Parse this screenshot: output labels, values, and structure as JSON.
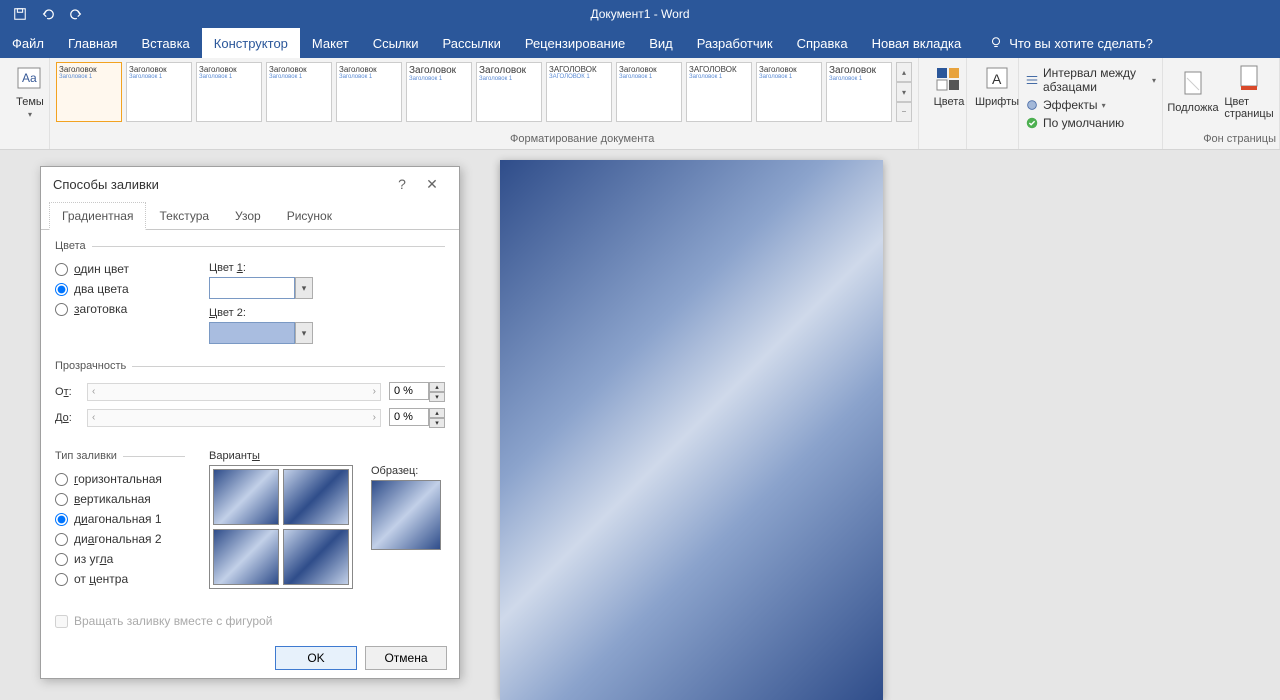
{
  "title": "Документ1 - Word",
  "tabs": [
    "Файл",
    "Главная",
    "Вставка",
    "Конструктор",
    "Макет",
    "Ссылки",
    "Рассылки",
    "Рецензирование",
    "Вид",
    "Разработчик",
    "Справка",
    "Новая вкладка"
  ],
  "active_tab": 3,
  "tellme": "Что вы хотите сделать?",
  "ribbon": {
    "themes": "Темы",
    "colors": "Цвета",
    "fonts": "Шрифты",
    "spacing": "Интервал между абзацами",
    "effects": "Эффекты",
    "default": "По умолчанию",
    "watermark": "Подложка",
    "pagecolor": "Цвет страницы",
    "format_label": "Форматирование документа",
    "pagebg_label": "Фон страницы",
    "style_heading": "Заголовок",
    "style_sub": "Заголовок 1",
    "style_headingU": "ЗАГОЛОВОК",
    "style_subU": "ЗАГОЛОВОК 1"
  },
  "dialog": {
    "title": "Способы заливки",
    "tabs": [
      "Градиентная",
      "Текстура",
      "Узор",
      "Рисунок"
    ],
    "active_tab": 0,
    "groups": {
      "colors": "Цвета",
      "transparency": "Прозрачность",
      "fill_type": "Тип заливки",
      "variants": "Варианты",
      "sample": "Образец:"
    },
    "color_radios": {
      "one": "один цвет",
      "two": "два цвета",
      "preset": "заготовка",
      "selected": "two"
    },
    "color1_label": "Цвет 1:",
    "color2_label": "Цвет 2:",
    "color1": "#2f4d8a",
    "color2": "#a9bde0",
    "trans_from": "От:",
    "trans_to": "До:",
    "trans_from_val": "0 %",
    "trans_to_val": "0 %",
    "direction_radios": {
      "horizontal": "горизонтальная",
      "vertical": "вертикальная",
      "diag1": "диагональная 1",
      "diag2": "диагональная 2",
      "corner": "из угла",
      "center": "от центра",
      "selected": "diag1"
    },
    "rotate_check": "Вращать заливку вместе с фигурой",
    "ok": "OK",
    "cancel": "Отмена"
  }
}
